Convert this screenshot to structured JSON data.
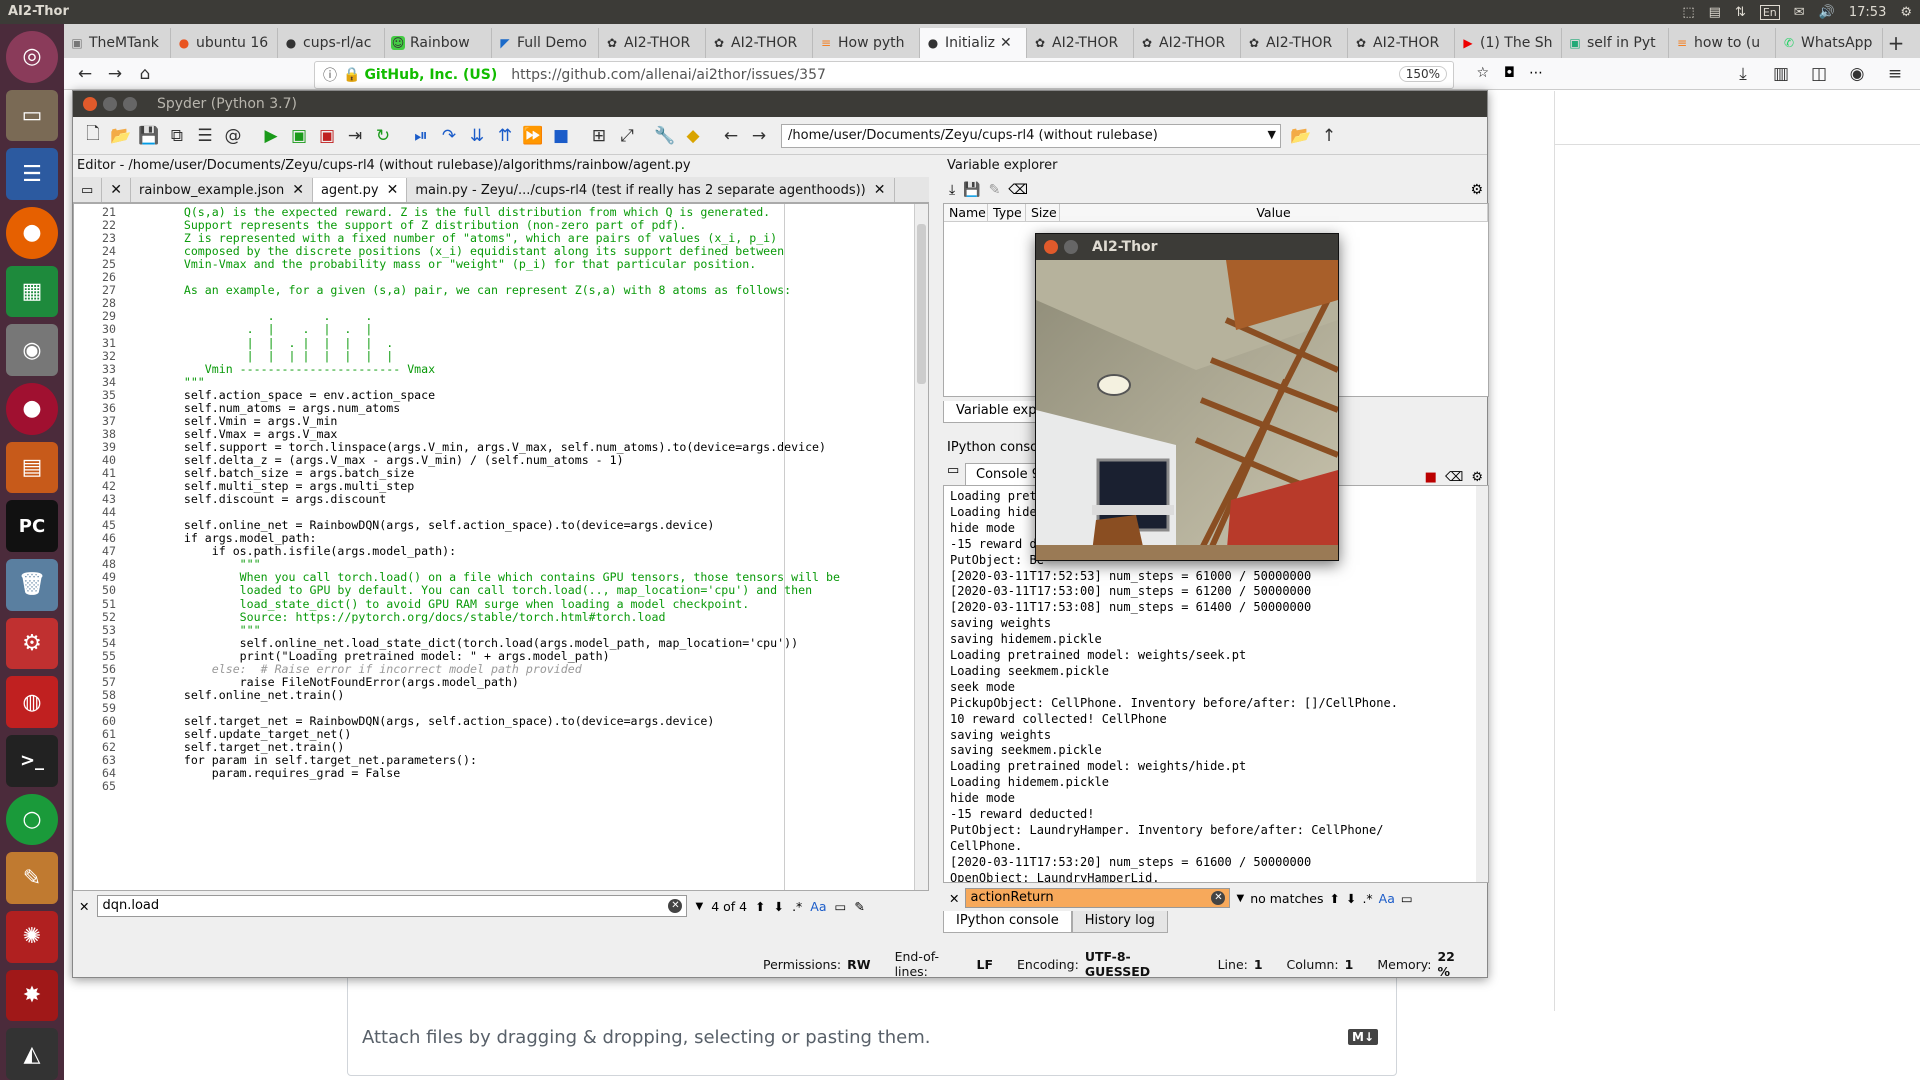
{
  "topbar": {
    "title": "AI2-Thor",
    "tray": {
      "keyboard": "En",
      "time": "17:53"
    }
  },
  "browser": {
    "tabs": [
      {
        "label": "TheMTank",
        "icon": "tank-icon"
      },
      {
        "label": "ubuntu 16",
        "icon": "ubuntu-icon"
      },
      {
        "label": "cups-rl/ac",
        "icon": "github-icon"
      },
      {
        "label": "Rainbow",
        "icon": "rainbow-icon"
      },
      {
        "label": "Full Demo",
        "icon": "vscode-icon"
      },
      {
        "label": "AI2-THOR",
        "icon": "ai2-icon"
      },
      {
        "label": "AI2-THOR",
        "icon": "ai2-icon"
      },
      {
        "label": "How pyth",
        "icon": "stack-icon"
      },
      {
        "label": "Initializ",
        "icon": "github-icon",
        "active": true
      },
      {
        "label": "AI2-THOR",
        "icon": "ai2-icon"
      },
      {
        "label": "AI2-THOR",
        "icon": "ai2-icon"
      },
      {
        "label": "AI2-THOR",
        "icon": "ai2-icon"
      },
      {
        "label": "AI2-THOR",
        "icon": "ai2-icon"
      },
      {
        "label": "(1) The Sh",
        "icon": "youtube-icon"
      },
      {
        "label": "self in Pyt",
        "icon": "xda-icon"
      },
      {
        "label": "how to (u",
        "icon": "stack-icon"
      },
      {
        "label": "WhatsApp",
        "icon": "whatsapp-icon"
      }
    ],
    "url_site": "GitHub, Inc. (US)",
    "url": "https://github.com/allenai/ai2thor/issues/357",
    "zoom": "150%",
    "attach_hint": "Attach files by dragging & dropping, selecting or pasting them.",
    "md_badge": "M↓"
  },
  "spyder": {
    "title": "Spyder (Python 3.7)",
    "working_dir": "/home/user/Documents/Zeyu/cups-rl4 (without rulebase)",
    "editor_header": "Editor - /home/user/Documents/Zeyu/cups-rl4 (without rulebase)/algorithms/rainbow/agent.py",
    "editor_tabs": [
      {
        "label": "rainbow_example.json"
      },
      {
        "label": "agent.py",
        "active": true
      },
      {
        "label": "main.py - Zeyu/.../cups-rl4 (test if really has 2 separate agenthoods))"
      }
    ],
    "code_lines": [
      {
        "n": "21",
        "t": "        Q(s,a) is the expected reward. Z is the full distribution from which Q is generated.",
        "c": "doc"
      },
      {
        "n": "22",
        "t": "        Support represents the support of Z distribution (non-zero part of pdf).",
        "c": "doc"
      },
      {
        "n": "23",
        "t": "        Z is represented with a fixed number of \"atoms\", which are pairs of values (x_i, p_i)",
        "c": "doc"
      },
      {
        "n": "24",
        "t": "        composed by the discrete positions (x_i) equidistant along its support defined between",
        "c": "doc"
      },
      {
        "n": "25",
        "t": "        Vmin-Vmax and the probability mass or \"weight\" (p_i) for that particular position.",
        "c": "doc"
      },
      {
        "n": "26",
        "t": "",
        "c": "doc"
      },
      {
        "n": "27",
        "t": "        As an example, for a given (s,a) pair, we can represent Z(s,a) with 8 atoms as follows:",
        "c": "doc"
      },
      {
        "n": "28",
        "t": "",
        "c": "doc"
      },
      {
        "n": "29",
        "t": "                    .       .     .",
        "c": "doc"
      },
      {
        "n": "30",
        "t": "                 .  |    .  |  .  |",
        "c": "doc"
      },
      {
        "n": "31",
        "t": "                 |  |  . |  |  |  |  .",
        "c": "doc"
      },
      {
        "n": "32",
        "t": "                 |  |  | |  |  |  |  |",
        "c": "doc"
      },
      {
        "n": "33",
        "t": "           Vmin ----------------------- Vmax",
        "c": "doc"
      },
      {
        "n": "34",
        "t": "        \"\"\"",
        "c": "doc"
      },
      {
        "n": "35",
        "t": "        self.action_space = env.action_space",
        "c": ""
      },
      {
        "n": "36",
        "t": "        self.num_atoms = args.num_atoms",
        "c": ""
      },
      {
        "n": "37",
        "t": "        self.Vmin = args.V_min",
        "c": ""
      },
      {
        "n": "38",
        "t": "        self.Vmax = args.V_max",
        "c": ""
      },
      {
        "n": "39",
        "t": "        self.support = torch.linspace(args.V_min, args.V_max, self.num_atoms).to(device=args.device)",
        "c": ""
      },
      {
        "n": "40",
        "t": "        self.delta_z = (args.V_max - args.V_min) / (self.num_atoms - 1)",
        "c": ""
      },
      {
        "n": "41",
        "t": "        self.batch_size = args.batch_size",
        "c": ""
      },
      {
        "n": "42",
        "t": "        self.multi_step = args.multi_step",
        "c": ""
      },
      {
        "n": "43",
        "t": "        self.discount = args.discount",
        "c": ""
      },
      {
        "n": "44",
        "t": "",
        "c": ""
      },
      {
        "n": "45",
        "t": "        self.online_net = RainbowDQN(args, self.action_space).to(device=args.device)",
        "c": ""
      },
      {
        "n": "46",
        "t": "        if args.model_path:",
        "c": ""
      },
      {
        "n": "47",
        "t": "            if os.path.isfile(args.model_path):",
        "c": ""
      },
      {
        "n": "48",
        "t": "                \"\"\"",
        "c": "doc"
      },
      {
        "n": "49",
        "t": "                When you call torch.load() on a file which contains GPU tensors, those tensors will be",
        "c": "doc"
      },
      {
        "n": "50",
        "t": "                loaded to GPU by default. You can call torch.load(.., map_location='cpu') and then",
        "c": "doc"
      },
      {
        "n": "51",
        "t": "                load_state_dict() to avoid GPU RAM surge when loading a model checkpoint.",
        "c": "doc"
      },
      {
        "n": "52",
        "t": "                Source: https://pytorch.org/docs/stable/torch.html#torch.load",
        "c": "doc"
      },
      {
        "n": "53",
        "t": "                \"\"\"",
        "c": "doc"
      },
      {
        "n": "54",
        "t": "                self.online_net.load_state_dict(torch.load(args.model_path, map_location='cpu'))",
        "c": ""
      },
      {
        "n": "55",
        "t": "                print(\"Loading pretrained model: \" + args.model_path)",
        "c": ""
      },
      {
        "n": "56",
        "t": "            else:  # Raise error if incorrect model path provided",
        "c": "cm"
      },
      {
        "n": "57",
        "t": "                raise FileNotFoundError(args.model_path)",
        "c": ""
      },
      {
        "n": "58",
        "t": "        self.online_net.train()",
        "c": ""
      },
      {
        "n": "59",
        "t": "",
        "c": ""
      },
      {
        "n": "60",
        "t": "        self.target_net = RainbowDQN(args, self.action_space).to(device=args.device)",
        "c": ""
      },
      {
        "n": "61",
        "t": "        self.update_target_net()",
        "c": ""
      },
      {
        "n": "62",
        "t": "        self.target_net.train()",
        "c": ""
      },
      {
        "n": "63",
        "t": "        for param in self.target_net.parameters():",
        "c": ""
      },
      {
        "n": "64",
        "t": "            param.requires_grad = False",
        "c": ""
      },
      {
        "n": "65",
        "t": "",
        "c": ""
      }
    ],
    "find": {
      "value": "dqn.load",
      "count": "4 of 4",
      "case_label": "Aa"
    },
    "status": {
      "permissions_label": "Permissions:",
      "permissions": "RW",
      "eol_label": "End-of-lines:",
      "eol": "LF",
      "encoding_label": "Encoding:",
      "encoding": "UTF-8-GUESSED",
      "line_label": "Line:",
      "line": "1",
      "column_label": "Column:",
      "column": "1",
      "memory_label": "Memory:",
      "memory": "22 %"
    },
    "variable_explorer": {
      "title": "Variable explorer",
      "columns": [
        "Name",
        "Type",
        "Size",
        "Value"
      ],
      "tab": "Variable explo"
    },
    "ipython": {
      "title": "IPython console",
      "console_tab": "Console 9",
      "lines": [
        "Loading pret",
        "Loading hide",
        "hide mode",
        "-15 reward de",
        "PutObject: Be",
        "[2020-03-11T17:52:53] num_steps = 61000 / 50000000",
        "[2020-03-11T17:53:00] num_steps = 61200 / 50000000",
        "[2020-03-11T17:53:08] num_steps = 61400 / 50000000",
        "saving weights",
        "saving hidemem.pickle",
        "Loading pretrained model: weights/seek.pt",
        "Loading seekmem.pickle",
        "seek mode",
        "PickupObject: CellPhone. Inventory before/after: []/CellPhone.",
        "10 reward collected! CellPhone",
        "saving weights",
        "saving seekmem.pickle",
        "Loading pretrained model: weights/hide.pt",
        "Loading hidemem.pickle",
        "hide mode",
        "-15 reward deducted!",
        "PutObject: LaundryHamper. Inventory before/after: CellPhone/",
        "CellPhone.",
        "[2020-03-11T17:53:20] num_steps = 61600 / 50000000",
        "OpenObject: LaundryHamperLid."
      ],
      "find_value": "actionReturn",
      "find_result": "no matches",
      "bottom_tabs": [
        "IPython console",
        "History log"
      ]
    }
  },
  "ai2_window": {
    "title": "AI2-Thor"
  },
  "colors": {
    "accent": "#2a9c2a",
    "docstring": "#0a9a0a",
    "find_highlight": "#f7a95b"
  }
}
